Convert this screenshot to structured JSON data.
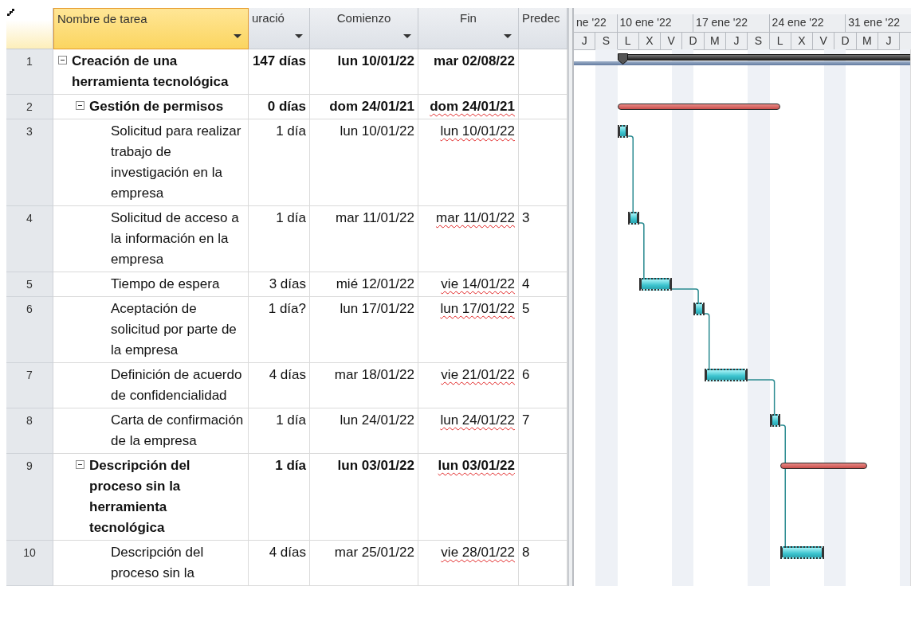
{
  "table": {
    "columns": [
      {
        "label": "Nombre de tarea",
        "selected": true,
        "dropdown": true
      },
      {
        "label": "uració",
        "selected": false,
        "dropdown": true
      },
      {
        "label": "Comienzo",
        "selected": false,
        "dropdown": true
      },
      {
        "label": "Fin",
        "selected": false,
        "dropdown": true
      },
      {
        "label": "Predec",
        "selected": false,
        "dropdown": false
      }
    ]
  },
  "timescale": {
    "weeks": [
      "ne '22",
      "10 ene '22",
      "17 ene '22",
      "24 ene '22",
      "31 ene '22"
    ],
    "days": [
      "J",
      "S",
      "L",
      "X",
      "V",
      "D",
      "M",
      "J",
      "S",
      "L",
      "X",
      "V",
      "D",
      "M",
      "J"
    ]
  },
  "tasks": [
    {
      "row": "1",
      "name": "Creación de una herramienta tecnológica",
      "kind": "project",
      "expanded": true,
      "duration": "147 días",
      "start": "lun 10/01/22",
      "finish": "mar 02/08/22",
      "spell_error": false,
      "children": [
        {
          "row": "2",
          "name": "Gestión de permisos",
          "kind": "summary",
          "expanded": true,
          "duration": "0 días",
          "start": "dom 24/01/21",
          "finish": "dom 24/01/21",
          "spell_error": true,
          "children": [
            {
              "row": "3",
              "name": "Solicitud para realizar trabajo de investigación en la empresa",
              "kind": "task",
              "duration": "1 día",
              "start": "lun 10/01/22",
              "finish": "lun 10/01/22",
              "spell_error": true
            },
            {
              "row": "4",
              "name": "Solicitud de acceso a la información en la empresa",
              "kind": "task",
              "duration": "1 día",
              "start": "mar 11/01/22",
              "finish": "mar 11/01/22",
              "spell_error": true,
              "predecessors": "3"
            },
            {
              "row": "5",
              "name": "Tiempo de espera",
              "kind": "task",
              "duration": "3 días",
              "start": "mié 12/01/22",
              "finish": "vie 14/01/22",
              "spell_error": true,
              "predecessors": "4"
            },
            {
              "row": "6",
              "name": "Aceptación de solicitud por parte de la empresa",
              "kind": "task",
              "duration": "1 día?",
              "start": "lun 17/01/22",
              "finish": "lun 17/01/22",
              "spell_error": true,
              "predecessors": "5"
            },
            {
              "row": "7",
              "name": "Definición de acuerdo de confidencialidad",
              "kind": "task",
              "duration": "4 días",
              "start": "mar 18/01/22",
              "finish": "vie 21/01/22",
              "spell_error": true,
              "predecessors": "6"
            },
            {
              "row": "8",
              "name": "Carta de confirmación de la empresa",
              "kind": "task",
              "duration": "1 día",
              "start": "lun 24/01/22",
              "finish": "lun 24/01/22",
              "spell_error": true,
              "predecessors": "7"
            }
          ]
        },
        {
          "row": "9",
          "name": "Descripción del proceso sin la herramienta tecnológica",
          "kind": "summary",
          "expanded": true,
          "duration": "1 día",
          "start": "lun 03/01/22",
          "finish": "lun 03/01/22",
          "spell_error": true,
          "children": [
            {
              "row": "10",
              "name": "Descripción del proceso sin la",
              "kind": "task",
              "duration": "4 días",
              "start": "mar 25/01/22",
              "finish": "vie 28/01/22",
              "spell_error": true,
              "predecessors": "8"
            }
          ]
        }
      ]
    }
  ]
}
